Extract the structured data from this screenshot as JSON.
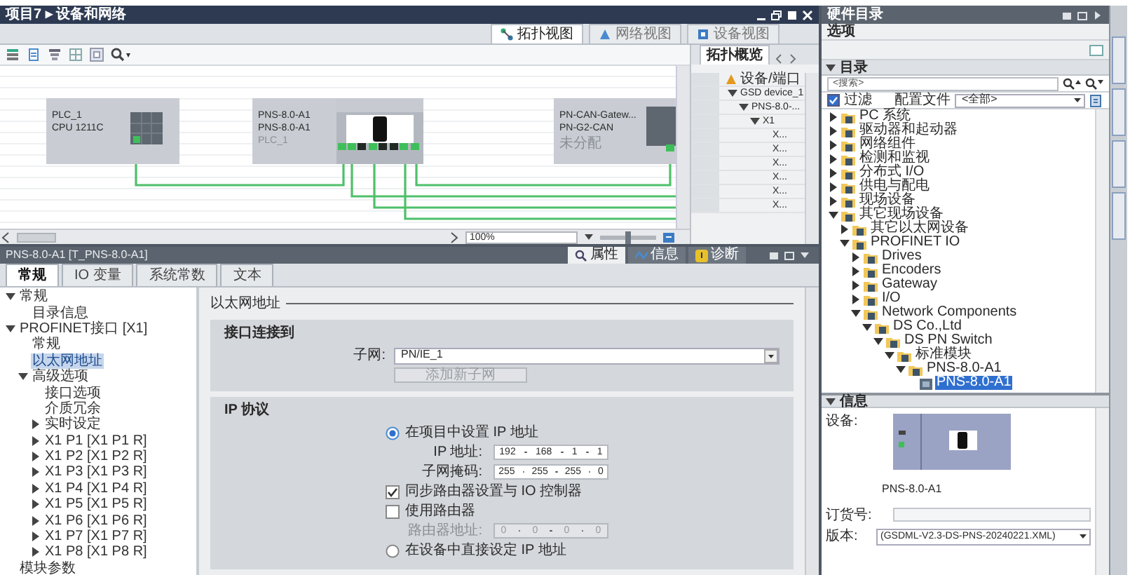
{
  "editor": {
    "breadcrumb": "项目7 ▸ 设备和网络",
    "view_tabs": [
      {
        "label": "拓扑视图",
        "selected": true
      },
      {
        "label": "网络视图",
        "selected": false
      },
      {
        "label": "设备视图",
        "selected": false
      }
    ],
    "devices": [
      {
        "kind": "plc",
        "name": "PLC_1",
        "type": "CPU 1211C"
      },
      {
        "kind": "switch",
        "name": "PNS-8.0-A1",
        "type": "PNS-8.0-A1",
        "assigned": "PLC_1"
      },
      {
        "kind": "gateway",
        "name": "PN-CAN-Gatew...",
        "type": "PN-G2-CAN",
        "assigned": "未分配"
      }
    ],
    "zoom": "100%",
    "zoom_slider": {
      "level": 0.5
    }
  },
  "overview": {
    "tab": "拓扑概览",
    "column": "设备/端口",
    "rows": [
      {
        "label": "GSD device_1",
        "expanded": true,
        "children": [
          {
            "label": "PNS-8.0-...",
            "expanded": true,
            "children": [
              {
                "label": "X1",
                "expanded": true,
                "children": [
                  {
                    "label": "X..."
                  },
                  {
                    "label": "X..."
                  },
                  {
                    "label": "X..."
                  },
                  {
                    "label": "X..."
                  },
                  {
                    "label": "X..."
                  },
                  {
                    "label": "X..."
                  }
                ]
              }
            ]
          }
        ]
      }
    ]
  },
  "inspector": {
    "title": "PNS-8.0-A1 [T_PNS-8.0-A1]",
    "panel_tabs": [
      {
        "label": "属性",
        "selected": true
      },
      {
        "label": "信息",
        "selected": false
      },
      {
        "label": "诊断",
        "selected": false
      }
    ],
    "tabs": [
      {
        "label": "常规",
        "selected": true
      },
      {
        "label": "IO 变量",
        "selected": false
      },
      {
        "label": "系统常数",
        "selected": false
      },
      {
        "label": "文本",
        "selected": false
      }
    ],
    "nav": [
      {
        "label": "常规",
        "expanded": true,
        "selected": false,
        "children": [
          {
            "label": "目录信息",
            "selected": false
          }
        ]
      },
      {
        "label": "PROFINET接口 [X1]",
        "expanded": true,
        "selected": false,
        "children": [
          {
            "label": "常规",
            "selected": false
          },
          {
            "label": "以太网地址",
            "selected": true
          },
          {
            "label": "高级选项",
            "expanded": true,
            "selected": false,
            "children": [
              {
                "label": "接口选项",
                "selected": false
              },
              {
                "label": "介质冗余",
                "selected": false
              },
              {
                "label": "实时设定",
                "expanded": false,
                "selected": false
              },
              {
                "label": "X1 P1 [X1 P1 R]",
                "expanded": false,
                "selected": false
              },
              {
                "label": "X1 P2 [X1 P2 R]",
                "expanded": false,
                "selected": false
              },
              {
                "label": "X1 P3 [X1 P3 R]",
                "expanded": false,
                "selected": false
              },
              {
                "label": "X1 P4 [X1 P4 R]",
                "expanded": false,
                "selected": false
              },
              {
                "label": "X1 P5 [X1 P5 R]",
                "expanded": false,
                "selected": false
              },
              {
                "label": "X1 P6 [X1 P6 R]",
                "expanded": false,
                "selected": false
              },
              {
                "label": "X1 P7 [X1 P7 R]",
                "expanded": false,
                "selected": false
              },
              {
                "label": "X1 P8 [X1 P8 R]",
                "expanded": false,
                "selected": false
              }
            ]
          }
        ]
      },
      {
        "label": "模块参数",
        "selected": false
      }
    ],
    "section_title": "以太网地址",
    "interface": {
      "title": "接口连接到",
      "subnet_label": "子网:",
      "subnet": "PN/IE_1",
      "add_button": "添加新子网",
      "add_disabled": true
    },
    "ip": {
      "title": "IP 协议",
      "items": [
        {
          "kind": "radio",
          "label": "在项目中设置 IP 地址",
          "selected": true
        },
        {
          "kind": "address",
          "label": "IP 地址:",
          "octets": [
            "192",
            "168",
            "1",
            "1"
          ],
          "disabled": false
        },
        {
          "kind": "address",
          "label": "子网掩码:",
          "octets": [
            "255",
            "255",
            "255",
            "0"
          ],
          "disabled": false
        },
        {
          "kind": "checkbox",
          "label": "同步路由器设置与 IO 控制器",
          "checked": true
        },
        {
          "kind": "checkbox",
          "label": "使用路由器",
          "checked": false
        },
        {
          "kind": "address",
          "label": "路由器地址:",
          "octets": [
            "0",
            "0",
            "0",
            "0"
          ],
          "disabled": true
        },
        {
          "kind": "radio",
          "label": "在设备中直接设定 IP 地址",
          "selected": false
        }
      ]
    }
  },
  "catalog": {
    "title": "硬件目录",
    "options_label": "选项",
    "catalog_label": "目录",
    "search_placeholder": "<搜索>",
    "filter": {
      "label": "过滤",
      "checked": true
    },
    "profile_label": "配置文件",
    "profile": "<全部>",
    "tree": [
      {
        "label": "PC 系统",
        "expanded": false,
        "selected": false
      },
      {
        "label": "驱动器和起动器",
        "expanded": false,
        "selected": false
      },
      {
        "label": "网络组件",
        "expanded": false,
        "selected": false
      },
      {
        "label": "检测和监视",
        "expanded": false,
        "selected": false
      },
      {
        "label": "分布式 I/O",
        "expanded": false,
        "selected": false
      },
      {
        "label": "供电与配电",
        "expanded": false,
        "selected": false
      },
      {
        "label": "现场设备",
        "expanded": false,
        "selected": false
      },
      {
        "label": "其它现场设备",
        "expanded": true,
        "selected": false,
        "children": [
          {
            "label": "其它以太网设备",
            "expanded": false,
            "selected": false
          },
          {
            "label": "PROFINET IO",
            "expanded": true,
            "selected": false,
            "children": [
              {
                "label": "Drives",
                "expanded": false,
                "selected": false
              },
              {
                "label": "Encoders",
                "expanded": false,
                "selected": false
              },
              {
                "label": "Gateway",
                "expanded": false,
                "selected": false
              },
              {
                "label": "I/O",
                "expanded": false,
                "selected": false
              },
              {
                "label": "Network Components",
                "expanded": true,
                "selected": false,
                "children": [
                  {
                    "label": "DS Co.,Ltd",
                    "expanded": true,
                    "selected": false,
                    "children": [
                      {
                        "label": "DS PN Switch",
                        "expanded": true,
                        "selected": false,
                        "children": [
                          {
                            "label": "标准模块",
                            "expanded": true,
                            "selected": false,
                            "children": [
                              {
                                "label": "PNS-8.0-A1",
                                "expanded": true,
                                "selected": false,
                                "children": [
                                  {
                                    "label": "PNS-8.0-A1",
                                    "selected": true
                                  }
                                ]
                              }
                            ]
                          }
                        ]
                      }
                    ]
                  }
                ]
              }
            ]
          }
        ]
      }
    ]
  },
  "info": {
    "title": "信息",
    "device_label": "设备:",
    "device_name": "PNS-8.0-A1",
    "order_label": "订货号:",
    "version_label": "版本:",
    "version": "(GSDML-V2.3-DS-PNS-20240221.XML)"
  }
}
